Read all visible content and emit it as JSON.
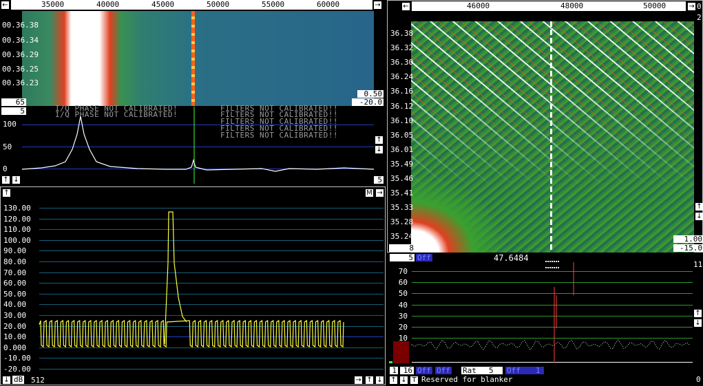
{
  "wide_waterfall": {
    "freq_ticks": [
      "35000",
      "40000",
      "45000",
      "50000",
      "55000",
      "60000"
    ],
    "time_labels": [
      "00.36.38",
      "00.36.34",
      "00.36.29",
      "00.36.25",
      "00.36.23"
    ],
    "box_left": "65",
    "box_gain": "0.50",
    "box_offset": "-20.0"
  },
  "wide_spectrum": {
    "avg_box": "5",
    "y_labels": [
      "100",
      "50",
      "0"
    ],
    "right_box": "5",
    "messages": [
      "I/Q PHASE NOT CALIBRATED!",
      "I/Q PHASE NOT CALIBRATED!",
      "FILTERS NOT CALIBRATED!!",
      "FILTERS NOT CALIBRATED!!",
      "FILTERS NOT CALIBRATED!!",
      "FILTERS NOT CALIBRATED!!",
      "FILTERS NOT CALIBRATED!!"
    ]
  },
  "baseband": {
    "y_labels": [
      "130.00",
      "120.00",
      "110.00",
      "100.00",
      "90.00",
      "80.00",
      "70.00",
      "60.00",
      "50.00",
      "40.00",
      "30.00",
      "20.00",
      "10.00",
      "0.000",
      "-10.00",
      "-20.00"
    ],
    "m_button": "M",
    "db_label": "dB",
    "fft_size": "512"
  },
  "hires_waterfall": {
    "freq_ticks": [
      "46000",
      "48000",
      "50000"
    ],
    "time_labels": [
      "36.38",
      "36.32",
      "36.30",
      "36.24",
      "36.16",
      "36.12",
      "36.10",
      "36.05",
      "36.01",
      "35.49",
      "35.46",
      "35.41",
      "35.33",
      "35.28",
      "35.24"
    ],
    "box_left": "8",
    "box_gain": "1.00",
    "box_offset": "-15.0",
    "right_digits": [
      "0",
      "2"
    ]
  },
  "hires_spectrum": {
    "avg_box": "5",
    "off_label": "Off",
    "frequency": "47.6484",
    "right_value": "11",
    "y_labels": [
      "70",
      "60",
      "50",
      "40",
      "30",
      "20",
      "10",
      "0"
    ],
    "s_meter_db": [
      70,
      60
    ]
  },
  "bottom_bar": {
    "box1": "1",
    "box2": "16",
    "off1": "Off",
    "off2": "Off",
    "rat_label": "Rat",
    "rat_value": "5",
    "off3": "Off",
    "off3_value": "1",
    "status": "Reserved for blanker",
    "corner": "0"
  },
  "colors": {
    "wf_green": "#2f7f55",
    "wf_teal": "#2a6f86",
    "grid_blue": "#1e3fbf",
    "grid_green": "#2a9a2a",
    "trace_yellow": "#ffff40"
  }
}
